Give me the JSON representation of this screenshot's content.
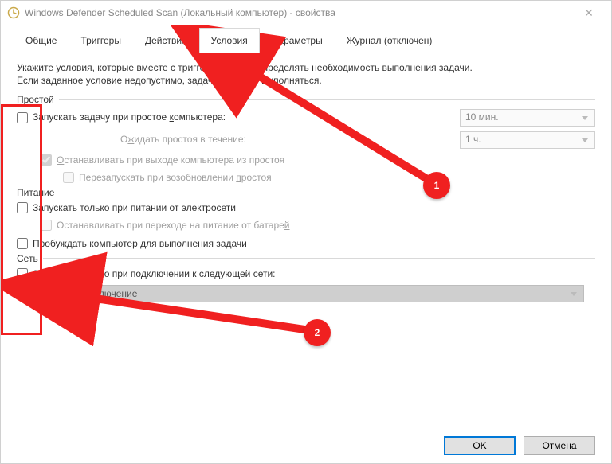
{
  "titlebar": {
    "title": "Windows Defender Scheduled Scan (Локальный компьютер) - свойства"
  },
  "tabs": [
    {
      "label": "Общие"
    },
    {
      "label": "Триггеры"
    },
    {
      "label": "Действия"
    },
    {
      "label": "Условия"
    },
    {
      "label": "Параметры"
    },
    {
      "label": "Журнал (отключен)"
    }
  ],
  "desc_line1": "Укажите условия, которые вместе с триггерами будут определять необходимость выполнения задачи.",
  "desc_line2": "Если заданное условие недопустимо, задача не будет выполняться.",
  "groups": {
    "idle": {
      "title": "Простой",
      "start_label_pre": "Запускать задачу при простое ",
      "start_underline": "к",
      "start_label_post": "омпьютера:",
      "idle_wait_select": "10 мин.",
      "idle_wait_label_pre": "О",
      "idle_wait_underline": "ж",
      "idle_wait_label_post": "идать простоя в течение:",
      "idle_duration_select": "1 ч.",
      "stop_label_pre": "",
      "stop_underline": "О",
      "stop_label_post": "станавливать при выходе компьютера из простоя",
      "restart_label_pre": "Перезапускать при возобновлении ",
      "restart_underline": "п",
      "restart_label_post": "ростоя"
    },
    "power": {
      "title": "Питание",
      "ac_label": "Запускать только при питании от электросети",
      "stop_batt_pre": "Останавливать при переходе на питание от батаре",
      "stop_batt_under": "й",
      "wake_pre": "Проб",
      "wake_under": "у",
      "wake_post": "ждать компьютер для выполнения задачи"
    },
    "network": {
      "title": "Сеть",
      "start_pre": "",
      "start_under": "З",
      "start_post": "апускать только при подключении к следующей сети:",
      "connection_select": "Любое подключение"
    }
  },
  "footer": {
    "ok": "OK",
    "cancel": "Отмена"
  },
  "callouts": {
    "c1": "1",
    "c2": "2"
  }
}
